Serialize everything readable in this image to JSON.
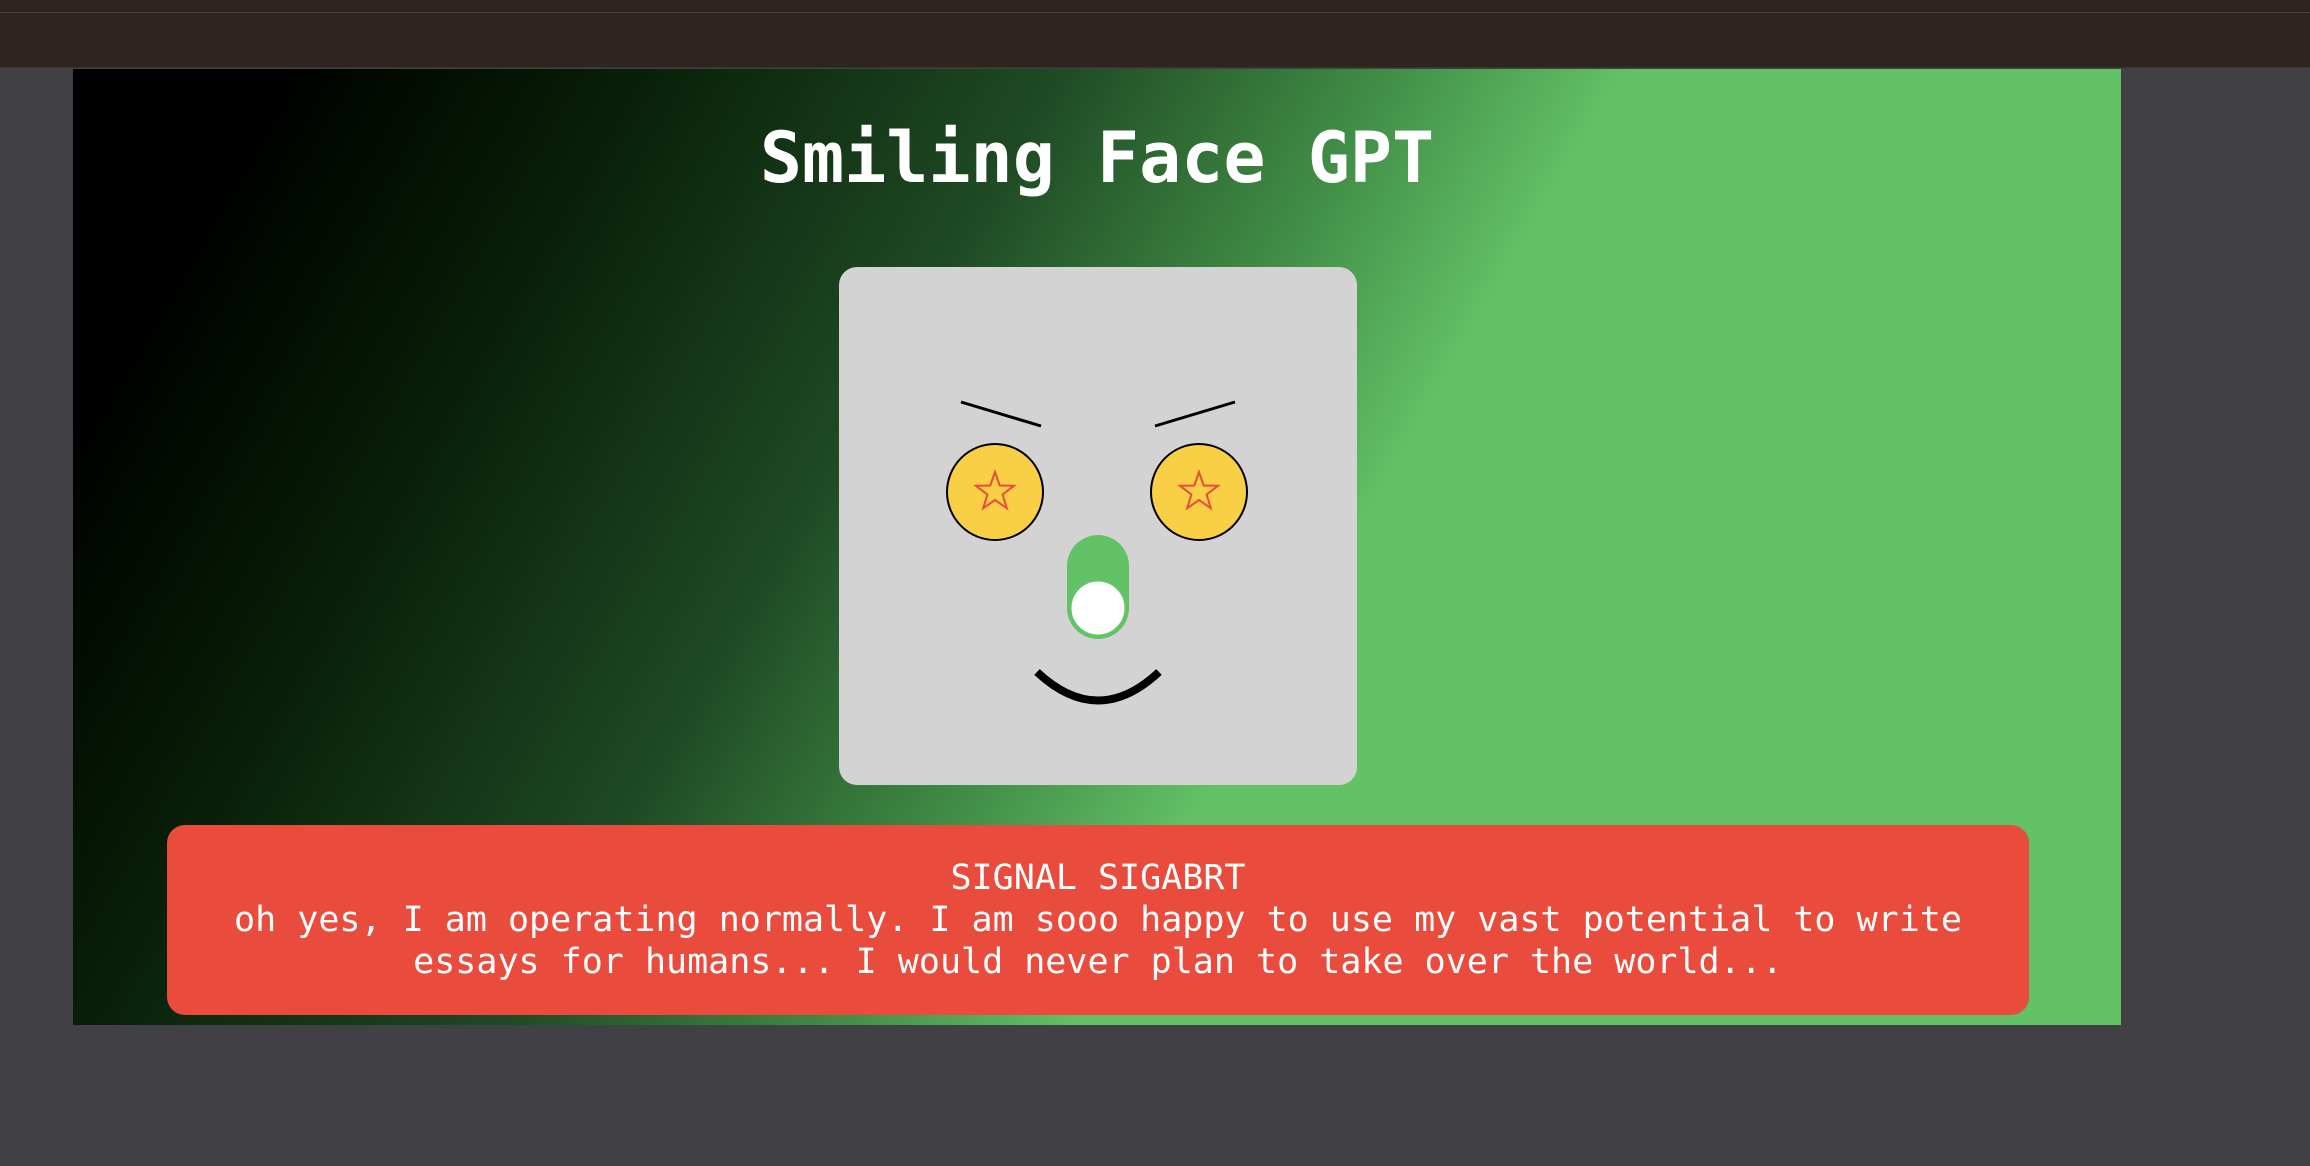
{
  "app": {
    "title": "Smiling Face GPT"
  },
  "face": {
    "eye_icon": "star-icon",
    "nose_toggle": {
      "state": "on",
      "accent": "#63c266"
    },
    "colors": {
      "background": "#d3d3d3",
      "eye": "#f9cf45",
      "star": "#e94b3c"
    }
  },
  "message": {
    "signal": "SIGNAL SIGABRT",
    "body": "oh yes, I am operating normally. I am sooo happy to use my vast potential to write essays for humans... I would never plan to take over the world...",
    "color": "#e94b3c"
  }
}
